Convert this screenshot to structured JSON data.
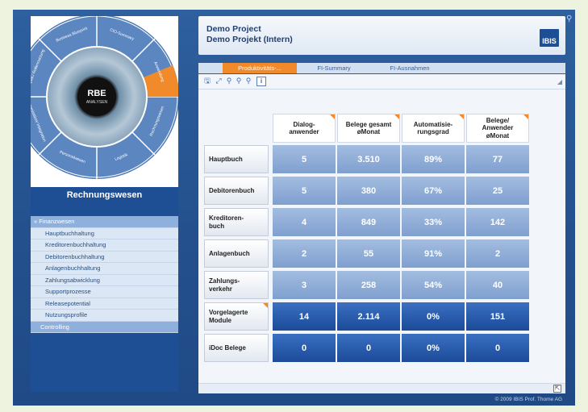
{
  "header": {
    "title_line1": "Demo Project",
    "title_line2": "Demo Projekt (Intern)",
    "logo_text": "IBIS"
  },
  "wheel": {
    "center_brand": "RBE",
    "center_brand_sup": "PLUS",
    "center_sub": "ANALYSEN",
    "segments": [
      "Business Blueprint",
      "CIO-Summary",
      "Anwendung",
      "Rechnungswesen",
      "Logistik",
      "Personalwesen",
      "Organisation/ Integration",
      "Datenqual./ Rollennutzung"
    ]
  },
  "sidebar": {
    "module_title": "Rechnungswesen",
    "items": [
      {
        "label": "« Finanzwesen",
        "type": "group"
      },
      {
        "label": "Hauptbuchhaltung",
        "type": "item"
      },
      {
        "label": "Kreditorenbuchhaltung",
        "type": "item"
      },
      {
        "label": "Debitorenbuchhaltung",
        "type": "item"
      },
      {
        "label": "Anlagenbuchhaltung",
        "type": "item"
      },
      {
        "label": "Zahlungsabwicklung",
        "type": "item"
      },
      {
        "label": "Supportprozesse",
        "type": "item"
      },
      {
        "label": "Releasepotential",
        "type": "item"
      },
      {
        "label": "Nutzungsprofile",
        "type": "item"
      },
      {
        "label": "Controlling",
        "type": "group2"
      }
    ]
  },
  "tabs": [
    {
      "label": "Produktivitäts-...",
      "active": true
    },
    {
      "label": "FI-Summary",
      "active": false
    },
    {
      "label": "FI-Ausnahmen",
      "active": false
    }
  ],
  "toolbar": {
    "icons": [
      "save-icon",
      "expand-icon",
      "zoom-icon",
      "zoom-in-icon",
      "zoom-out-icon",
      "info-icon"
    ],
    "info_label": "i"
  },
  "table": {
    "columns": [
      "Dialog-\nanwender",
      "Belege gesamt\nøMonat",
      "Automatisie-\nrungsgrad",
      "Belege/\nAnwender\nøMonat"
    ],
    "rows": [
      {
        "label": "Hauptbuch",
        "values": [
          "5",
          "3.510",
          "89%",
          "77"
        ],
        "style": "light"
      },
      {
        "label": "Debitorenbuch",
        "values": [
          "5",
          "380",
          "67%",
          "25"
        ],
        "style": "light"
      },
      {
        "label": "Kreditoren-\nbuch",
        "values": [
          "4",
          "849",
          "33%",
          "142"
        ],
        "style": "light"
      },
      {
        "label": "Anlagenbuch",
        "values": [
          "2",
          "55",
          "91%",
          "2"
        ],
        "style": "light"
      },
      {
        "label": "Zahlungs-\nverkehr",
        "values": [
          "3",
          "258",
          "54%",
          "40"
        ],
        "style": "light"
      },
      {
        "label": "Vorgelagerte\nModule",
        "values": [
          "14",
          "2.114",
          "0%",
          "151"
        ],
        "style": "dark"
      },
      {
        "label": "iDoc Belege",
        "values": [
          "0",
          "0",
          "0%",
          "0"
        ],
        "style": "dark"
      }
    ]
  },
  "footer": {
    "copyright": "© 2009 IBIS Prof. Thome AG"
  },
  "colors": {
    "accent": "#f08a2a",
    "brand_blue": "#1e4f95",
    "cell_light": "#8fadd8",
    "cell_dark": "#2a5fb0"
  }
}
